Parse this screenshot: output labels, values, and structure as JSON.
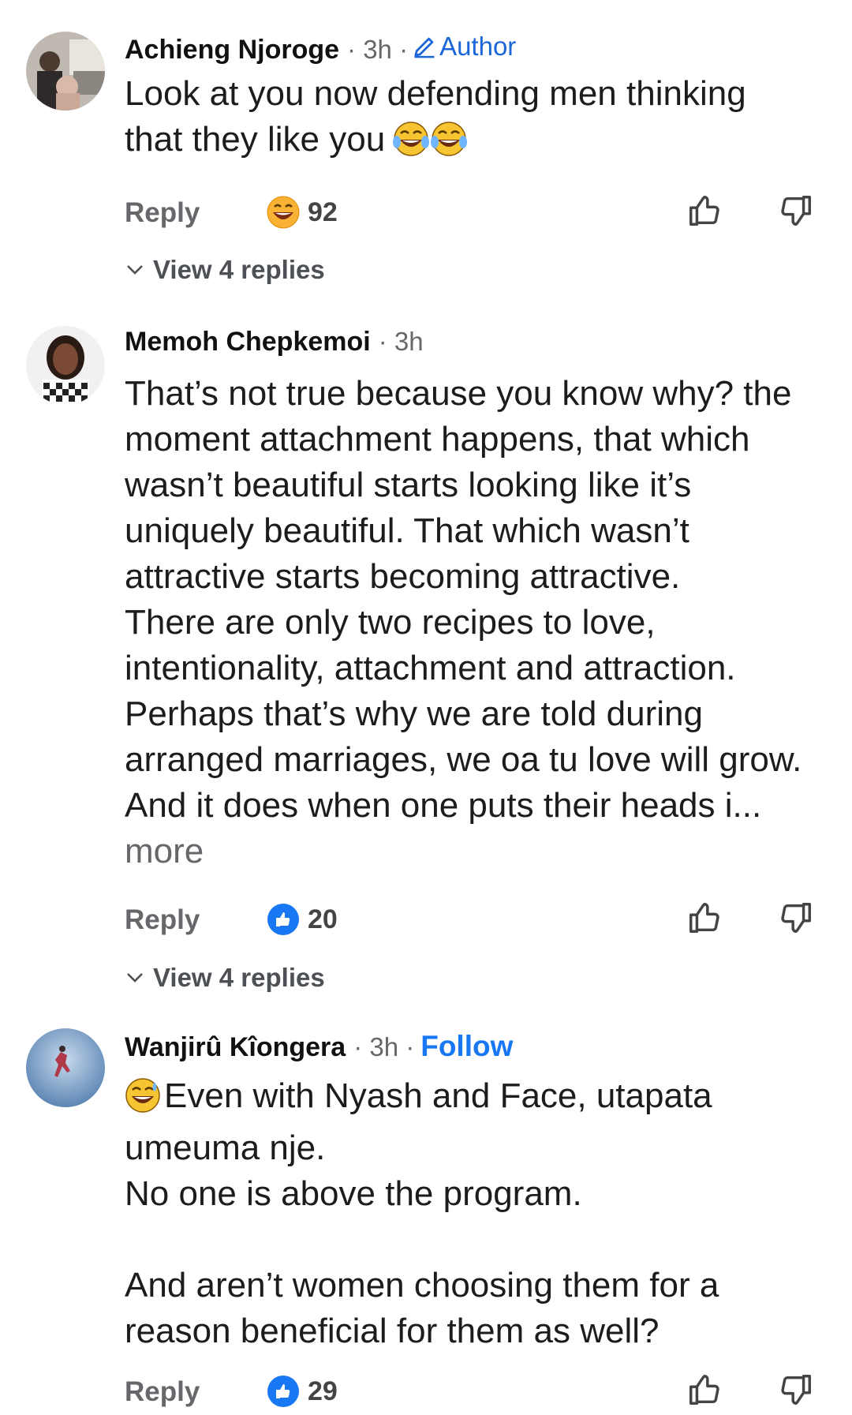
{
  "comments": [
    {
      "name": "Achieng Njoroge",
      "time": "· 3h ·",
      "author_label": "Author",
      "lines": [
        "Look at you now defending men thinking",
        "that they like you"
      ],
      "reply_label": "Reply",
      "reaction_count": "92",
      "reaction_icon": "grin-emoji-icon",
      "view_replies": "View 4 replies"
    },
    {
      "name": "Memoh Chepkemoi",
      "time": "· 3h",
      "lines": [
        "That’s not true because you know why? the",
        "moment attachment happens, that which",
        "wasn’t beautiful starts looking like it’s",
        "uniquely beautiful. That which wasn’t",
        "attractive starts becoming attractive.",
        "There are only two recipes to love,",
        "intentionality, attachment and attraction.",
        "Perhaps that’s why we are told during",
        "arranged marriages, we oa tu love will grow.",
        "And it does when one puts their heads i..."
      ],
      "more_label": "more",
      "reply_label": "Reply",
      "reaction_count": "20",
      "reaction_icon": "like-reaction-icon",
      "view_replies": "View 4 replies"
    },
    {
      "name": "Wanjirû Kîongera",
      "time": "· 3h ·",
      "follow_label": "Follow",
      "lines": [
        "Even with Nyash and Face, utapata",
        "umeuma nje.",
        "No one is above the program.",
        "",
        "And aren’t women choosing them for a",
        "reason beneficial for them as well?"
      ],
      "reply_label": "Reply",
      "reaction_count": "29",
      "reaction_icon": "like-reaction-icon"
    }
  ],
  "colors": {
    "link_blue": "#1877f2",
    "meta_gray": "#65676b"
  }
}
